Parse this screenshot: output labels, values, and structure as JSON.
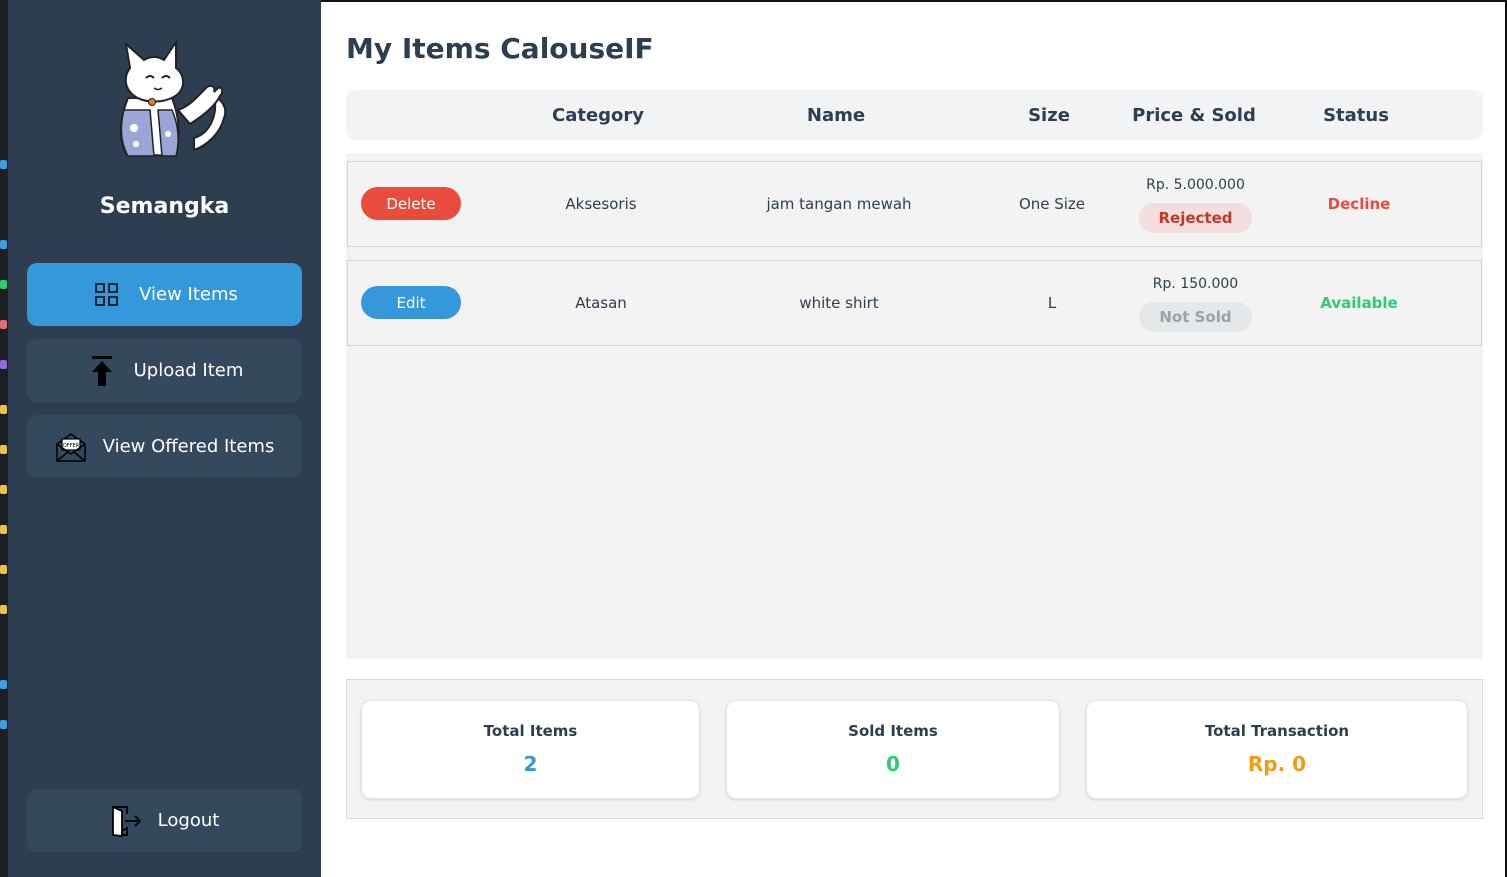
{
  "sidebar": {
    "username": "Semangka",
    "nav": {
      "view_items": "View Items",
      "upload_item": "Upload Item",
      "view_offered": "View Offered Items",
      "logout": "Logout"
    }
  },
  "page": {
    "title": "My Items CalouseIF"
  },
  "table": {
    "headers": {
      "category": "Category",
      "name": "Name",
      "size": "Size",
      "price_sold": "Price & Sold",
      "status": "Status"
    },
    "rows": [
      {
        "action": "Delete",
        "category": "Aksesoris",
        "name": "jam tangan mewah",
        "size": "One Size",
        "price": "Rp. 5.000.000",
        "sold": "Rejected",
        "status": "Decline"
      },
      {
        "action": "Edit",
        "category": "Atasan",
        "name": "white shirt",
        "size": "L",
        "price": "Rp. 150.000",
        "sold": "Not Sold",
        "status": "Available"
      }
    ]
  },
  "summary": {
    "total_items_label": "Total Items",
    "total_items_value": "2",
    "sold_items_label": "Sold Items",
    "sold_items_value": "0",
    "total_transaction_label": "Total Transaction",
    "total_transaction_value": "Rp. 0"
  },
  "colors": {
    "sidebar_bg": "#2c3e50",
    "nav_active": "#3498db",
    "nav_button": "#34495e",
    "delete": "#e74c3c",
    "edit": "#3498db",
    "decline": "#e74c3c",
    "available": "#2ecc71",
    "total_items_value": "#3498db",
    "sold_items_value": "#2ecc71",
    "total_transaction_value": "#f39c12"
  }
}
